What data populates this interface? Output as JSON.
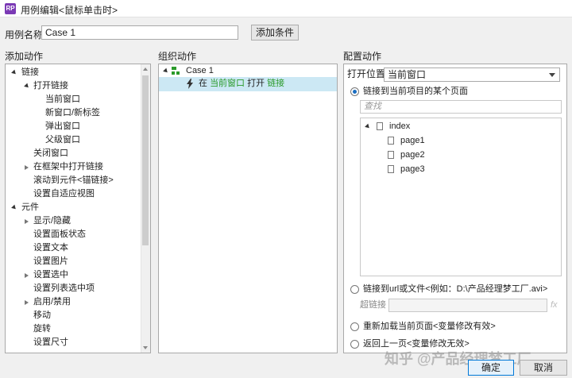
{
  "window": {
    "app_icon": "RP",
    "title": "用例编辑<鼠标单击时>"
  },
  "case": {
    "name_label": "用例名称",
    "name_value": "Case 1",
    "add_condition": "添加条件"
  },
  "sections": {
    "add_action": "添加动作",
    "organize_action": "组织动作",
    "configure_action": "配置动作"
  },
  "add_tree": {
    "link": "链接",
    "open_link": "打开链接",
    "current_window": "当前窗口",
    "new_window": "新窗口/新标签",
    "popup": "弹出窗口",
    "parent_window": "父级窗口",
    "close_window": "关闭窗口",
    "open_in_frame": "在框架中打开链接",
    "scroll_to": "滚动到元件<锚链接>",
    "adaptive_view": "设置自适应视图",
    "widget": "元件",
    "show_hide": "显示/隐藏",
    "panel_state": "设置面板状态",
    "set_text": "设置文本",
    "set_image": "设置图片",
    "set_selected": "设置选中",
    "list_selected": "设置列表选中项",
    "enable_disable": "启用/禁用",
    "move": "移动",
    "rotate": "旋转",
    "set_size": "设置尺寸"
  },
  "organize": {
    "case_label": "Case 1",
    "action_prefix": "在",
    "action_target": "当前窗口",
    "action_verb": "打开",
    "action_object": "链接"
  },
  "configure": {
    "open_in_label": "打开位置",
    "open_in_value": "当前窗口",
    "option_page": "链接到当前项目的某个页面",
    "search_placeholder": "查找",
    "pages": {
      "root": "index",
      "children": [
        "page1",
        "page2",
        "page3"
      ]
    },
    "option_url": "链接到url或文件<例如：D:\\产品经理梦工厂.avi>",
    "hyperlink_label": "超链接",
    "fx": "fx",
    "option_reload": "重新加载当前页面<变量修改有效>",
    "option_back": "返回上一页<变量修改无效>"
  },
  "footer": {
    "ok": "确定",
    "cancel": "取消"
  },
  "watermark": "知乎 @产品经理梦工厂",
  "colors": {
    "selection": "#cce8f4",
    "highlight_text": "#2a9a2a",
    "app_icon": "#7b3ab5",
    "radio_on": "#1b6ec2"
  }
}
